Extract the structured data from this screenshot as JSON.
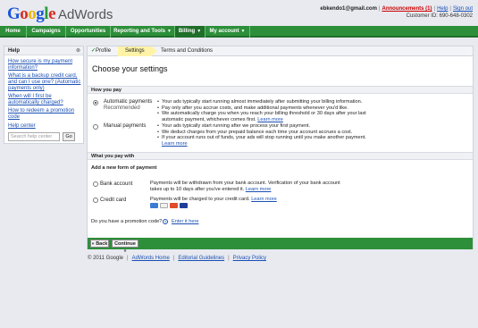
{
  "header": {
    "logo_google": "Google",
    "logo_adwords": "AdWords",
    "email": "ebkendo1@gmail.com",
    "announcements": "Announcements (1)",
    "help": "Help",
    "sign_out": "Sign out",
    "customer_id": "Customer ID: 690-648-0302"
  },
  "nav": {
    "tabs": [
      {
        "label": "Home"
      },
      {
        "label": "Campaigns"
      },
      {
        "label": "Opportunities"
      },
      {
        "label": "Reporting and Tools"
      },
      {
        "label": "Billing"
      },
      {
        "label": "My account"
      }
    ],
    "selected": "Billing"
  },
  "help_panel": {
    "title": "Help",
    "close": "⊗",
    "items": [
      "How secure is my payment information?",
      "What is a backup credit card, and can I use one? (Automatic payments only)",
      "When will I first be automatically charged?",
      "How to redeem a promotion code"
    ],
    "help_center": "Help center",
    "search_placeholder": "Search help center",
    "go": "Go"
  },
  "steps": {
    "profile": "Profile",
    "settings": "Settings",
    "terms": "Terms and Conditions"
  },
  "main": {
    "title": "Choose your settings",
    "how_you_pay": "How you pay",
    "auto": {
      "label": "Automatic payments",
      "sub": "Recommended",
      "bullets": [
        "Your ads typically start running almost immediately after submitting your billing information.",
        "Pay only after you accrue costs, and make additional payments whenever you'd like.",
        "We automatically charge you when you reach your billing threshold or 30 days after your last automatic payment, whichever comes first."
      ],
      "learn_more": "Learn more"
    },
    "manual": {
      "label": "Manual payments",
      "bullets": [
        "Your ads typically start running after we process your first payment.",
        "We deduct charges from your prepaid balance each time your account accrues a cost.",
        "If your account runs out of funds, your ads will stop running until you make another payment."
      ],
      "learn_more": "Learn more"
    },
    "what_you_pay_with": "What you pay with",
    "add_new_form": "Add a new form of payment",
    "bank": {
      "label": "Bank account",
      "desc": "Payments will be withdrawn from your bank account. Verification of your bank account takes up to 10 days after you've entered it.",
      "learn_more": "Learn more"
    },
    "credit": {
      "label": "Credit card",
      "desc": "Payments will be charged to your credit card.",
      "learn_more": "Learn more"
    },
    "promo_question": "Do you have a promotion code?",
    "promo_link": "Enter it here",
    "back": "« Back",
    "continue": "Continue »"
  },
  "footer": {
    "copyright": "© 2011 Google",
    "links": [
      "AdWords Home",
      "Editorial Guidelines",
      "Privacy Policy"
    ]
  },
  "colors": {
    "nav_green": "#2d8f3a",
    "link_blue": "#1a4fb3",
    "announcement_red": "#cc0000",
    "current_step_yellow": "#fff3a8"
  }
}
